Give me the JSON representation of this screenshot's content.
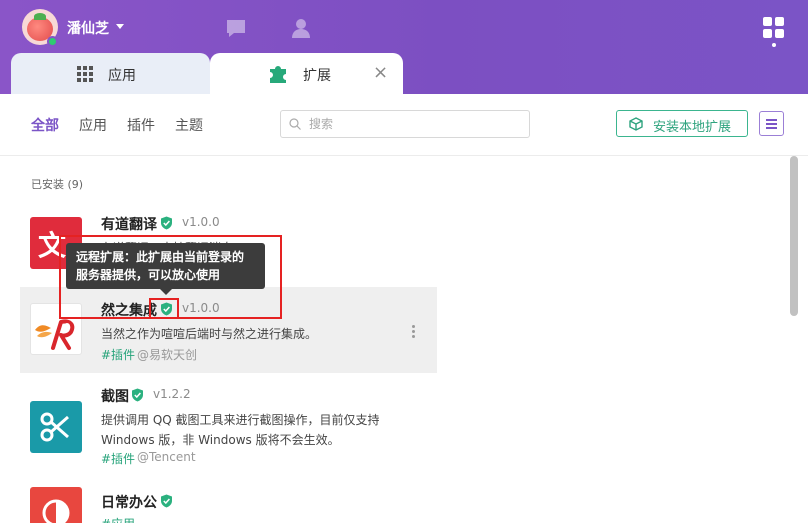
{
  "header": {
    "username": "潘仙芝",
    "icons": [
      "chat-icon",
      "user-icon",
      "apps-grid-icon"
    ]
  },
  "tabs": [
    {
      "label": "应用",
      "icon": "grid-icon",
      "active": false
    },
    {
      "label": "扩展",
      "icon": "puzzle-icon",
      "active": true,
      "close": "×"
    }
  ],
  "filters": [
    {
      "label": "全部",
      "active": true
    },
    {
      "label": "应用",
      "active": false
    },
    {
      "label": "插件",
      "active": false
    },
    {
      "label": "主题",
      "active": false
    }
  ],
  "search": {
    "placeholder": "搜索",
    "value": ""
  },
  "install_button": {
    "label": "安装本地扩展"
  },
  "section": {
    "title": "已安装 (9)"
  },
  "extensions": [
    {
      "name": "有道翻译",
      "version": "v1.0.0",
      "desc": "有道翻译，支持翻译消息",
      "tag": "",
      "author": "",
      "logo_color": "#e02c3c"
    },
    {
      "name": "然之集成",
      "version": "v1.0.0",
      "desc": "当然之作为喧喧后端时与然之进行集成。",
      "tag": "#插件",
      "author": "@易软天创",
      "logo_color": "#ffffff"
    },
    {
      "name": "截图",
      "version": "v1.2.2",
      "desc": "提供调用 QQ 截图工具来进行截图操作，目前仅支持 Windows 版，非 Windows 版将不会生效。",
      "tag": "#插件",
      "author": "@Tencent",
      "logo_color": "#1a9aa8"
    },
    {
      "name": "日常办公",
      "version": "",
      "desc": "",
      "tag": "#应用",
      "author": "",
      "logo_color": "#e8473f"
    }
  ],
  "tooltip": {
    "text": "远程扩展：此扩展由当前登录的服务器提供，可以放心使用"
  },
  "colors": {
    "accent": "#7b55c7",
    "green": "#2ea37e",
    "header": "#7e50c4"
  }
}
